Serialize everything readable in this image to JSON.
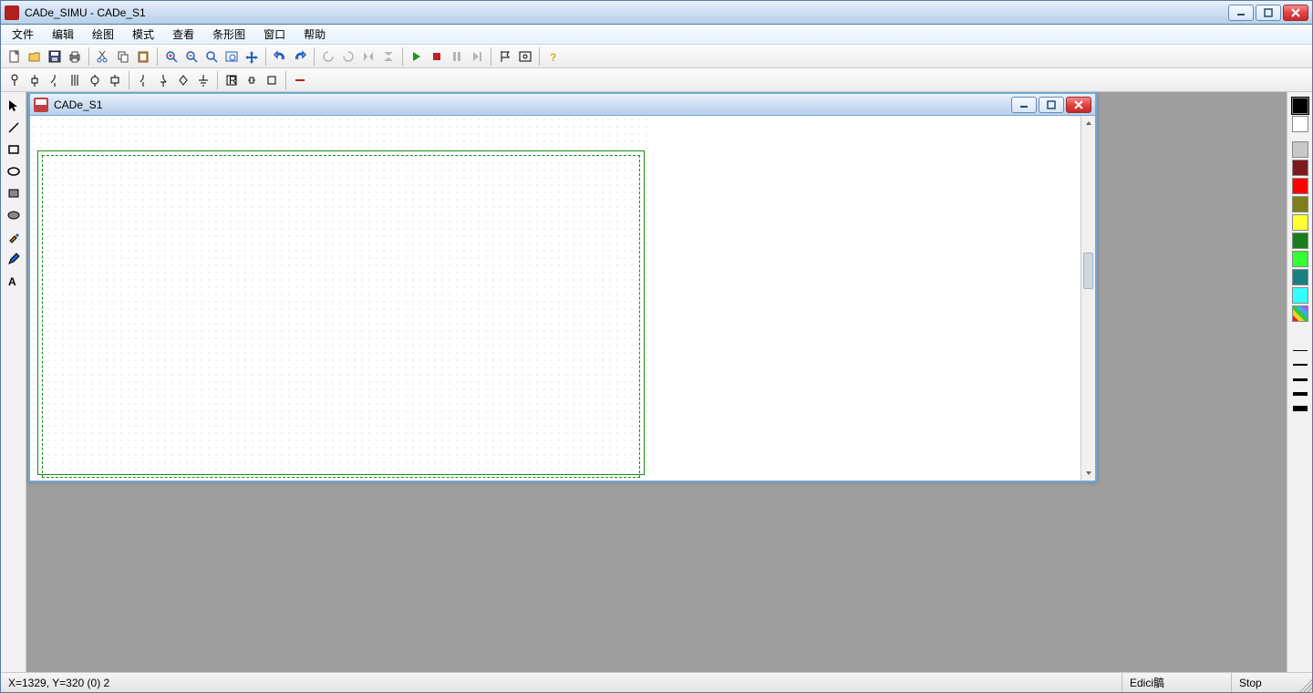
{
  "titlebar": {
    "title": "CADe_SIMU - CADe_S1"
  },
  "menu": {
    "items": [
      "文件",
      "编辑",
      "绘图",
      "模式",
      "查看",
      "条形图",
      "窗口",
      "帮助"
    ]
  },
  "child": {
    "title": "CADe_S1"
  },
  "statusbar": {
    "coords": "X=1329, Y=320 (0) 2",
    "mode": "Edici髇",
    "state": "Stop"
  },
  "colors": {
    "palette": [
      "#000000",
      "#ffffff",
      "#c8c8c8",
      "#7f1a1a",
      "#ff0000",
      "#7f7f1a",
      "#ffff33",
      "#1a7f1a",
      "#33ff33",
      "#1a7f7f",
      "#33ffff"
    ]
  },
  "line_weights": [
    1,
    2,
    3,
    4,
    6
  ]
}
